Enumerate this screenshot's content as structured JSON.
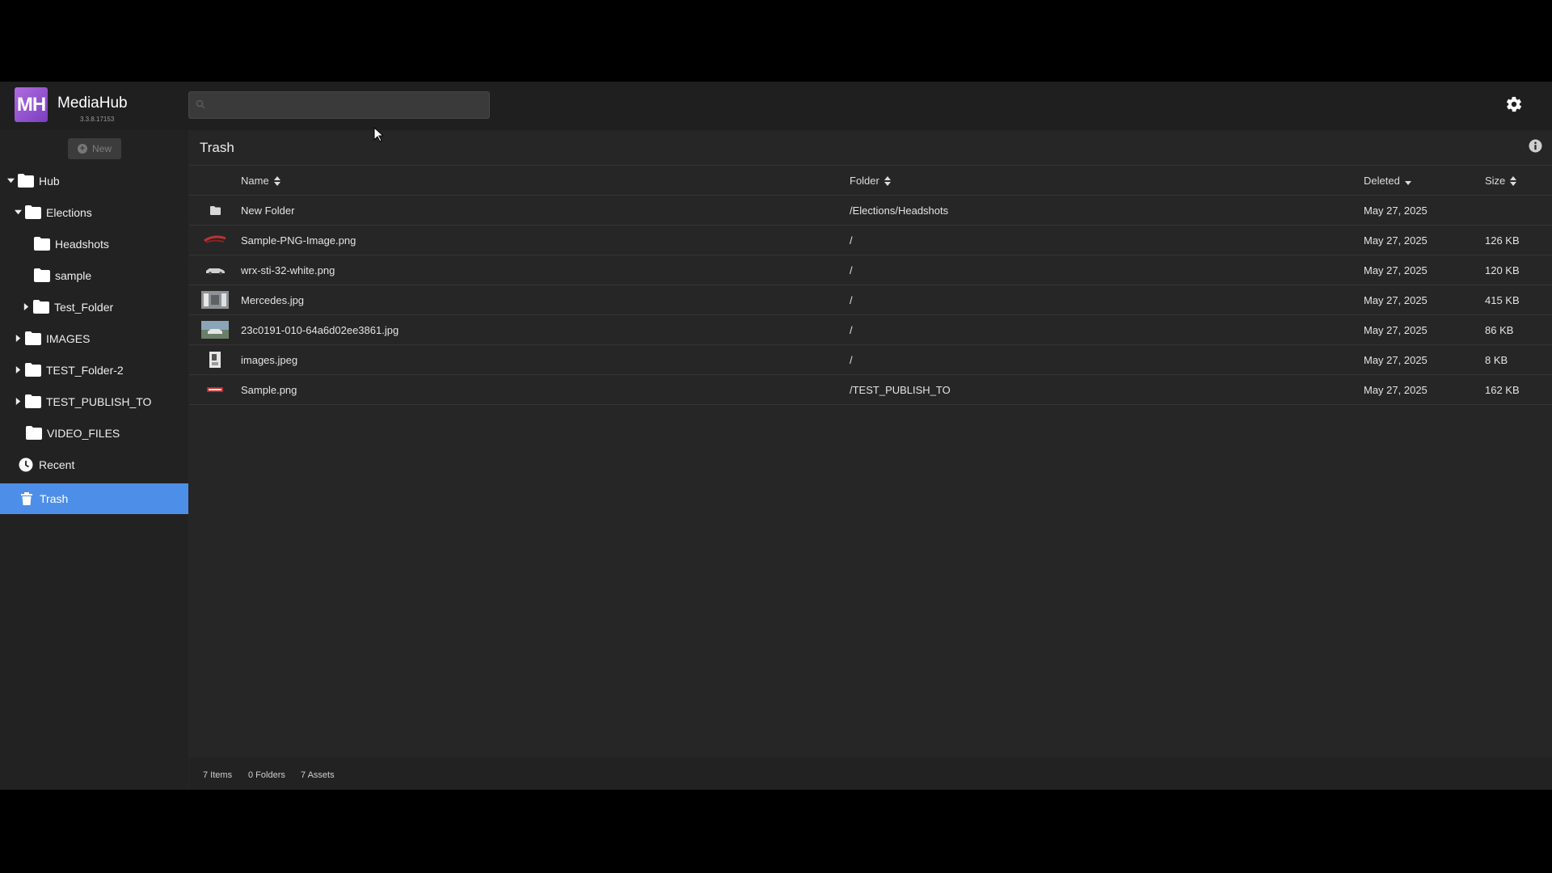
{
  "header": {
    "logo_text": "MH",
    "app_name": "MediaHub",
    "version": "3.3.8.17153",
    "search_placeholder": "",
    "icons": {
      "search": "search-icon",
      "settings": "gear-icon"
    }
  },
  "sidebar": {
    "new_label": "New",
    "tree": [
      {
        "label": "Hub",
        "level": 0,
        "expanded": true
      },
      {
        "label": "Elections",
        "level": 1,
        "expanded": true
      },
      {
        "label": "Headshots",
        "level": 2
      },
      {
        "label": "sample",
        "level": 2
      },
      {
        "label": "Test_Folder",
        "level": 2,
        "collapsed": true
      },
      {
        "label": "IMAGES",
        "level": 1,
        "collapsed": true
      },
      {
        "label": "TEST_Folder-2",
        "level": 1,
        "collapsed": true
      },
      {
        "label": "TEST_PUBLISH_TO",
        "level": 1,
        "collapsed": true
      },
      {
        "label": "VIDEO_FILES",
        "level": 1
      }
    ],
    "recent_label": "Recent",
    "trash_label": "Trash",
    "active_color": "#4d8fe8"
  },
  "main": {
    "title": "Trash",
    "columns": {
      "name": "Name",
      "folder": "Folder",
      "deleted": "Deleted",
      "size": "Size"
    },
    "rows": [
      {
        "name": "New Folder",
        "folder": "/Elections/Headshots",
        "deleted": "May 27, 2025",
        "size": "",
        "thumb": "folder-icon"
      },
      {
        "name": "Sample-PNG-Image.png",
        "folder": "/",
        "deleted": "May 27, 2025",
        "size": "126 KB",
        "thumb": "image-thumbnail"
      },
      {
        "name": "wrx-sti-32-white.png",
        "folder": "/",
        "deleted": "May 27, 2025",
        "size": "120 KB",
        "thumb": "image-thumbnail"
      },
      {
        "name": "Mercedes.jpg",
        "folder": "/",
        "deleted": "May 27, 2025",
        "size": "415 KB",
        "thumb": "image-thumbnail"
      },
      {
        "name": "23c0191-010-64a6d02ee3861.jpg",
        "folder": "/",
        "deleted": "May 27, 2025",
        "size": "86 KB",
        "thumb": "image-thumbnail"
      },
      {
        "name": "images.jpeg",
        "folder": "/",
        "deleted": "May 27, 2025",
        "size": "8 KB",
        "thumb": "image-thumbnail"
      },
      {
        "name": "Sample.png",
        "folder": "/TEST_PUBLISH_TO",
        "deleted": "May 27, 2025",
        "size": "162 KB",
        "thumb": "image-thumbnail"
      }
    ]
  },
  "footer": {
    "items": "7 Items",
    "folders": "0 Folders",
    "assets": "7 Assets"
  }
}
